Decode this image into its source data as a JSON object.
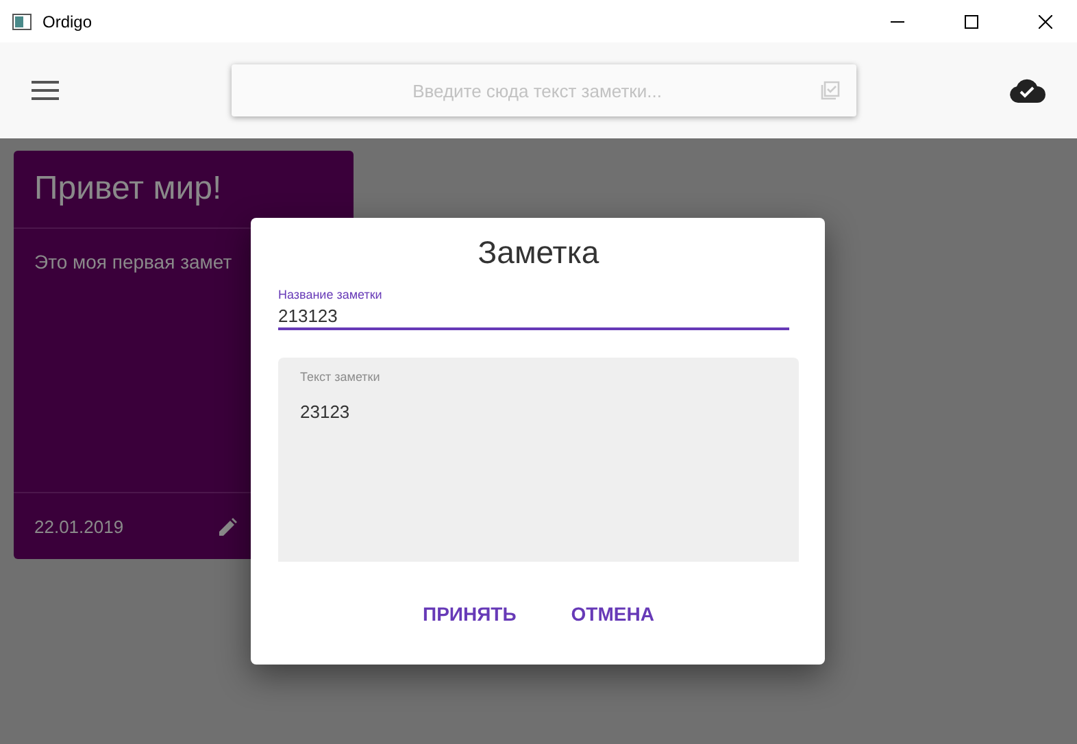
{
  "window": {
    "title": "Ordigo"
  },
  "toolbar": {
    "search": {
      "placeholder": "Введите сюда текст заметки..."
    }
  },
  "notes": [
    {
      "title": "Привет мир!",
      "text": "Это моя первая замет",
      "date": "22.01.2019"
    }
  ],
  "dialog": {
    "title": "Заметка",
    "name_label": "Название заметки",
    "name_value": "213123",
    "text_label": "Текст заметки",
    "text_value": "23123",
    "buttons": [
      "ПРИНЯТЬ",
      "ОТМЕНА"
    ]
  }
}
